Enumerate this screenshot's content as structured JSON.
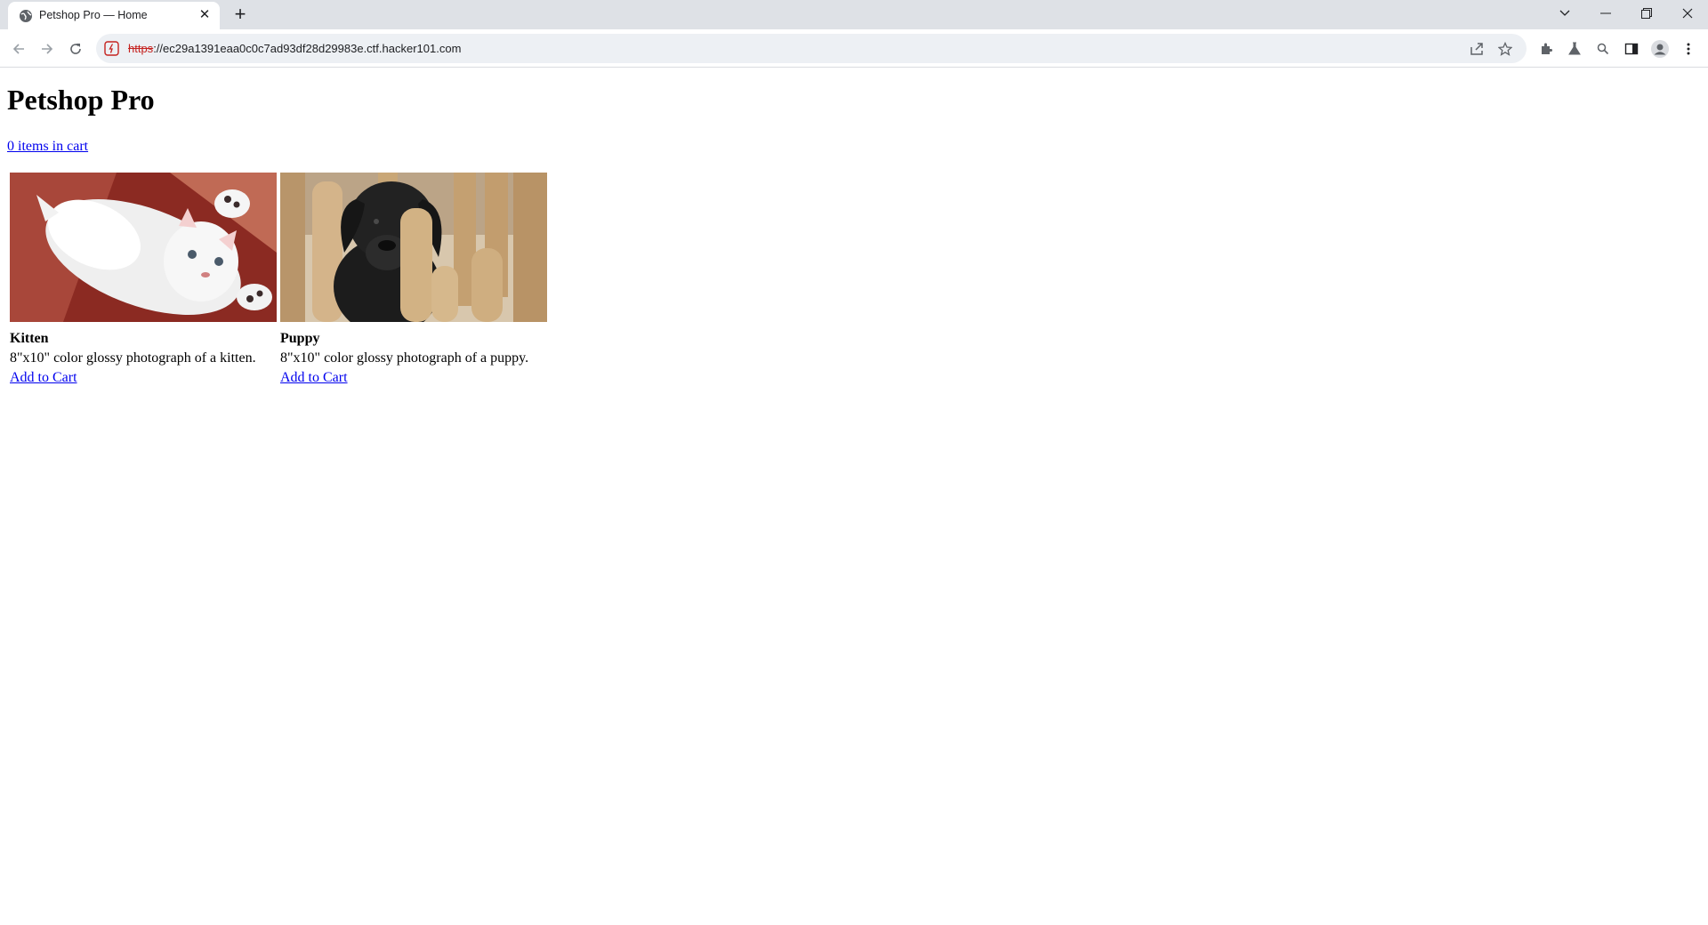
{
  "browser": {
    "tab_title": "Petshop Pro — Home",
    "url_scheme": "https",
    "url_rest": "://ec29a1391eaa0c0c7ad93df28d29983e.ctf.hacker101.com"
  },
  "page": {
    "heading": "Petshop Pro",
    "cart_link": "0 items in cart"
  },
  "products": [
    {
      "name": "Kitten",
      "description": "8\"x10\" color glossy photograph of a kitten.",
      "add_label": "Add to Cart"
    },
    {
      "name": "Puppy",
      "description": "8\"x10\" color glossy photograph of a puppy.",
      "add_label": "Add to Cart"
    }
  ],
  "colors": {
    "link": "#0000ee",
    "tabstrip": "#dee1e6",
    "omnibox": "#edf0f4",
    "insecure": "#c5221f"
  }
}
